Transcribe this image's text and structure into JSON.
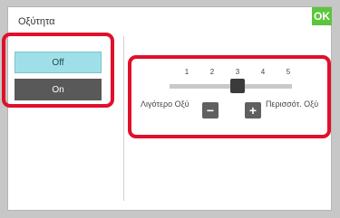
{
  "header": {
    "title": "Οξύτητα",
    "ok_label": "OK"
  },
  "mode": {
    "options": [
      {
        "label": "Off",
        "selected": true
      },
      {
        "label": "On",
        "selected": false
      }
    ]
  },
  "sharpness": {
    "scale": [
      "1",
      "2",
      "3",
      "4",
      "5"
    ],
    "value": 3,
    "less_label": "Λιγότερο Οξύ",
    "more_label": "Περισσότ. Οξύ",
    "minus_symbol": "−",
    "plus_symbol": "+"
  },
  "colors": {
    "ok_green": "#5bc63c",
    "highlight_red": "#e0102b",
    "selected_cyan": "#9fe0e8",
    "button_gray": "#595959"
  }
}
